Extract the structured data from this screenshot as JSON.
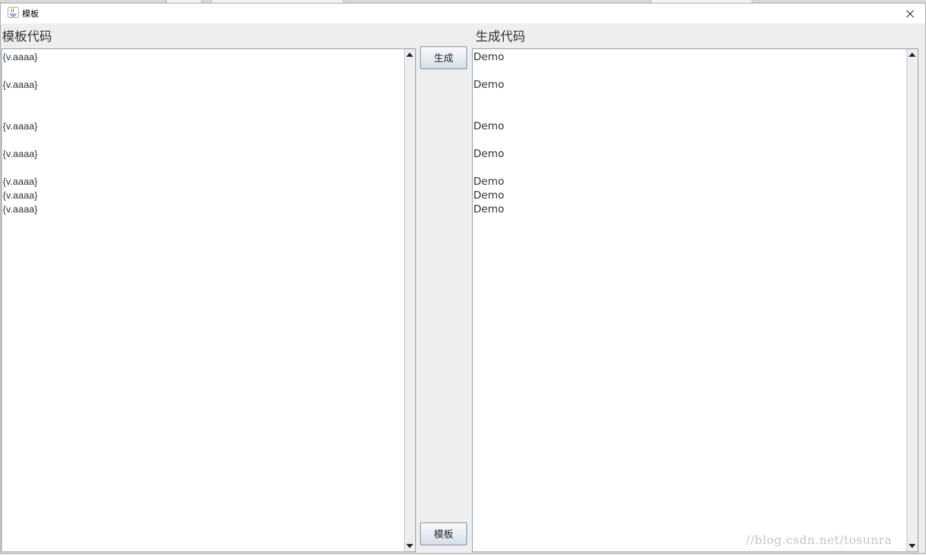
{
  "window": {
    "title": "模板",
    "close_glyph": "✕"
  },
  "left_panel": {
    "label": "模板代码",
    "lines": [
      "{v.aaaa}",
      "{v.aaaa}",
      "{v.aaaa}",
      "{v.aaaa}",
      "{v.aaaa}",
      "{v.aaaa}",
      "{v.aaaa}"
    ]
  },
  "right_panel": {
    "label": "生成代码",
    "lines": [
      "Demo",
      "Demo",
      "Demo",
      "Demo",
      "Demo",
      "Demo",
      "Demo"
    ]
  },
  "buttons": {
    "generate": "生成",
    "template": "模板"
  },
  "watermark": "//blog.csdn.net/tosunra"
}
